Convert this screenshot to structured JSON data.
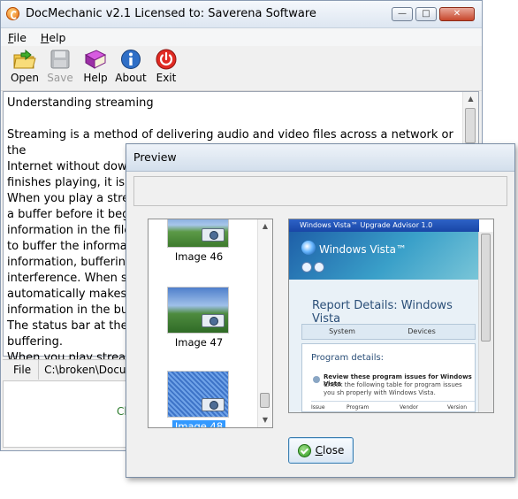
{
  "window": {
    "title": "DocMechanic v2.1   Licensed to: Saverena Software",
    "buttons": {
      "minimize": "—",
      "maximize": "□",
      "close": "✕"
    }
  },
  "menu": {
    "file": "File",
    "help": "Help"
  },
  "toolbar": {
    "open": "Open",
    "save": "Save",
    "help": "Help",
    "about": "About",
    "exit": "Exit"
  },
  "document": {
    "text": "Understanding streaming\n\nStreaming is a method of delivering audio and video files across a network or the\nInternet without dow\nfinishes playing, it is n\nWhen you play a strea\na buffer before it begi\ninformation in the file\nto buffer the informat\ninformation, buffering\ninterference. When st\nautomatically makes a\ninformation in the buf\nThe status bar at the b\nbuffering.\nWhen you play stream\nabout the quality of th"
  },
  "status": {
    "label": "File",
    "path": "C:\\broken\\Docum"
  },
  "bottom_pane": {
    "text": "Cl"
  },
  "dialog": {
    "title": "Preview",
    "thumbnails": [
      {
        "caption": "Image 46",
        "selected": false
      },
      {
        "caption": "Image 47",
        "selected": false
      },
      {
        "caption": "Image 48",
        "selected": true
      }
    ],
    "preview": {
      "window_title": "Windows Vista™ Upgrade Advisor 1.0",
      "logo": "Windows Vista™",
      "heading": "Report Details: Windows Vista",
      "tabs": [
        "System",
        "Devices"
      ],
      "section_title": "Program details:",
      "item_title": "Review these program issues for Windows Vista",
      "item_desc": "Check the following table for program issues you sh properly with Windows Vista.",
      "table_headers": [
        "Issue",
        "Program",
        "Vendor",
        "Version"
      ]
    },
    "close_button": "Close"
  }
}
